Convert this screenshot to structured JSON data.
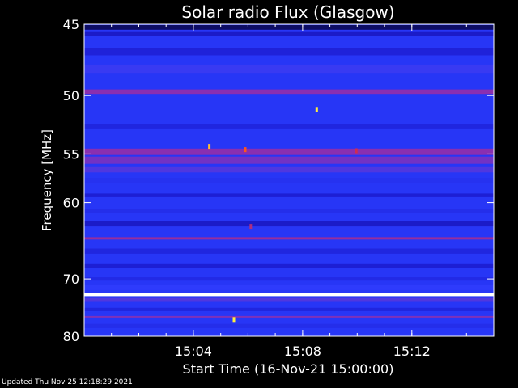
{
  "chart_data": {
    "type": "heatmap",
    "title": "Solar radio Flux (Glasgow)",
    "ylabel": "Frequency [MHz]",
    "xlabel": "Start Time (16-Nov-21 15:00:00)",
    "y_axis": {
      "range": [
        45,
        80
      ],
      "reversed": true,
      "scale": "reciprocal",
      "ticks": [
        45,
        50,
        55,
        60,
        70,
        80
      ]
    },
    "x_axis": {
      "range": [
        "15:00:00",
        "15:15:00"
      ],
      "ticks": [
        "15:04",
        "15:08",
        "15:12"
      ]
    },
    "colormap": [
      "#000000",
      "#1c1cd0",
      "#2a3cff",
      "#8a2fb0",
      "#ff2a10",
      "#ffff40",
      "#ffffff"
    ],
    "background_level": 0.3,
    "bands": [
      {
        "center_mhz": 45.2,
        "width_mhz": 0.3,
        "level": 0.08
      },
      {
        "center_mhz": 45.6,
        "width_mhz": 0.3,
        "level": 0.16
      },
      {
        "center_mhz": 46.8,
        "width_mhz": 0.5,
        "level": 0.2
      },
      {
        "center_mhz": 48.0,
        "width_mhz": 0.6,
        "level": 0.36
      },
      {
        "center_mhz": 49.7,
        "width_mhz": 0.35,
        "level": 0.5
      },
      {
        "center_mhz": 52.5,
        "width_mhz": 0.4,
        "level": 0.22
      },
      {
        "center_mhz": 54.8,
        "width_mhz": 0.6,
        "level": 0.5
      },
      {
        "center_mhz": 55.6,
        "width_mhz": 0.7,
        "level": 0.46
      },
      {
        "center_mhz": 56.5,
        "width_mhz": 0.6,
        "level": 0.4
      },
      {
        "center_mhz": 57.6,
        "width_mhz": 0.5,
        "level": 0.28
      },
      {
        "center_mhz": 59.2,
        "width_mhz": 0.4,
        "level": 0.18
      },
      {
        "center_mhz": 61.0,
        "width_mhz": 0.5,
        "level": 0.26
      },
      {
        "center_mhz": 62.5,
        "width_mhz": 0.6,
        "level": 0.16
      },
      {
        "center_mhz": 64.3,
        "width_mhz": 0.3,
        "level": 0.52
      },
      {
        "center_mhz": 66.0,
        "width_mhz": 0.7,
        "level": 0.22
      },
      {
        "center_mhz": 68.0,
        "width_mhz": 0.6,
        "level": 0.18
      },
      {
        "center_mhz": 70.0,
        "width_mhz": 0.5,
        "level": 0.24
      },
      {
        "center_mhz": 71.3,
        "width_mhz": 0.9,
        "level": 0.34
      },
      {
        "center_mhz": 72.5,
        "width_mhz": 0.45,
        "level": 1.0
      },
      {
        "center_mhz": 73.3,
        "width_mhz": 0.5,
        "level": 0.4
      },
      {
        "center_mhz": 75.0,
        "width_mhz": 0.6,
        "level": 0.22
      },
      {
        "center_mhz": 76.3,
        "width_mhz": 0.3,
        "level": 0.48
      },
      {
        "center_mhz": 78.0,
        "width_mhz": 0.8,
        "level": 0.26
      }
    ],
    "spots": [
      {
        "time": "15:08:31",
        "freq_mhz": 51.1,
        "level": 0.82
      },
      {
        "time": "15:04:35",
        "freq_mhz": 54.3,
        "level": 0.78
      },
      {
        "time": "15:05:54",
        "freq_mhz": 54.6,
        "level": 0.7
      },
      {
        "time": "15:09:58",
        "freq_mhz": 54.7,
        "level": 0.6
      },
      {
        "time": "15:06:06",
        "freq_mhz": 62.8,
        "level": 0.55
      },
      {
        "time": "15:05:29",
        "freq_mhz": 76.8,
        "level": 0.82
      }
    ]
  },
  "footer": {
    "updated": "Updated Thu Nov 25 12:18:29 2021"
  }
}
